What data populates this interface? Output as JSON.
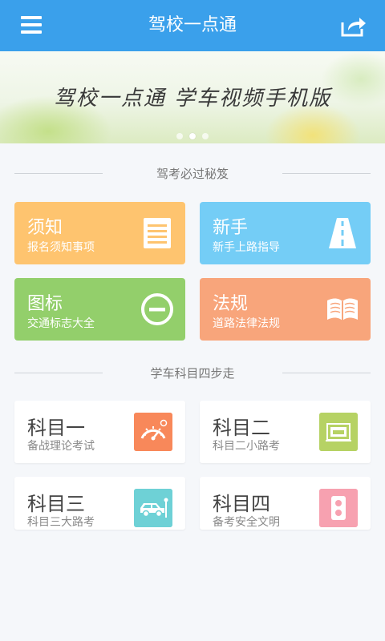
{
  "header": {
    "title": "驾校一点通",
    "menu_icon": "menu-icon",
    "share_icon": "share-icon"
  },
  "banner": {
    "text": "驾校一点通  学车视频手机版",
    "page_count": 3,
    "active_page": 2
  },
  "section1": {
    "title": "驾考必过秘笈"
  },
  "tiles": [
    {
      "title": "须知",
      "subtitle": "报名须知事项",
      "icon": "document-icon",
      "color": "#fec46f"
    },
    {
      "title": "新手",
      "subtitle": "新手上路指导",
      "icon": "road-icon",
      "color": "#74cdf6"
    },
    {
      "title": "图标",
      "subtitle": "交通标志大全",
      "icon": "no-entry-sign-icon",
      "color": "#93cf6b"
    },
    {
      "title": "法规",
      "subtitle": "道路法律法规",
      "icon": "book-icon",
      "color": "#f8a57b"
    }
  ],
  "section2": {
    "title": "学车科目四步走"
  },
  "subjects": [
    {
      "title": "科目一",
      "subtitle": "备战理论考试",
      "icon": "speedometer-icon",
      "color": "#f8885a"
    },
    {
      "title": "科目二",
      "subtitle": "科目二小路考",
      "icon": "garage-icon",
      "color": "#b6d264"
    },
    {
      "title": "科目三",
      "subtitle": "科目三大路考",
      "icon": "car-icon",
      "color": "#6ed1d6"
    },
    {
      "title": "科目四",
      "subtitle": "备考安全文明",
      "icon": "traffic-light-icon",
      "color": "#f7a1b0"
    }
  ]
}
